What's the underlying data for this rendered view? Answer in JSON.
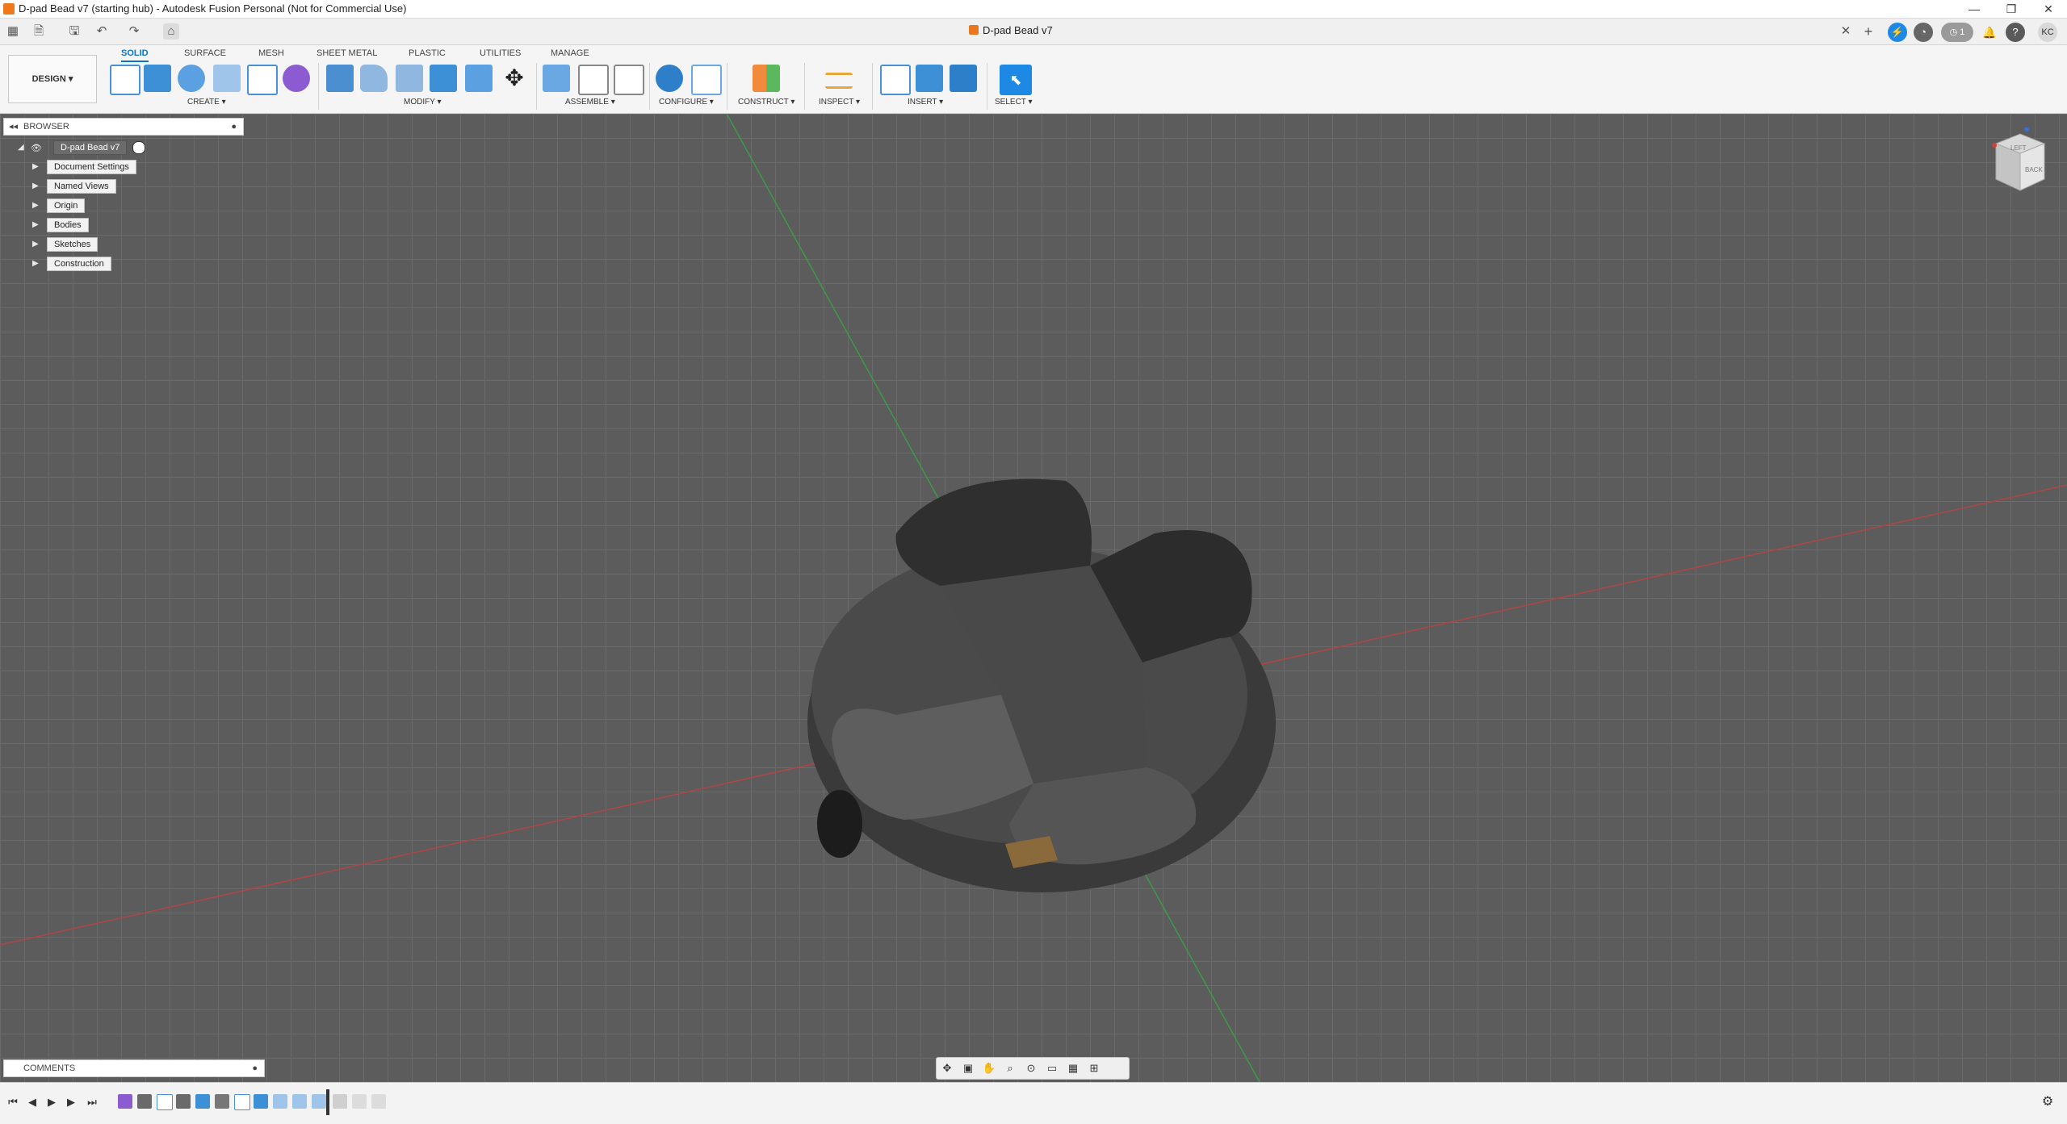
{
  "window": {
    "title": "D-pad Bead v7 (starting hub) - Autodesk Fusion Personal (Not for Commercial Use)",
    "minimize": "—",
    "restore": "❐",
    "close": "✕"
  },
  "quickbar": {
    "document_tab": "D-pad Bead v7",
    "tab_close": "✕",
    "add_tab": "+",
    "job_count": "1",
    "user_initials": "KC",
    "help": "?"
  },
  "ribbon": {
    "workspace": "DESIGN ▾",
    "tabs": [
      "SOLID",
      "SURFACE",
      "MESH",
      "SHEET METAL",
      "PLASTIC",
      "UTILITIES",
      "MANAGE"
    ],
    "groups": [
      "CREATE ▾",
      "MODIFY ▾",
      "ASSEMBLE ▾",
      "CONFIGURE ▾",
      "CONSTRUCT ▾",
      "INSPECT ▾",
      "INSERT ▾",
      "SELECT ▾"
    ]
  },
  "browser": {
    "header": "BROWSER",
    "root": "D-pad Bead v7",
    "items": [
      "Document Settings",
      "Named Views",
      "Origin",
      "Bodies",
      "Sketches",
      "Construction"
    ]
  },
  "comments": {
    "header": "COMMENTS"
  },
  "viewcube": {
    "top_label": "LEFT",
    "back_label": "BACK"
  },
  "colors": {
    "accent": "#0a74c8",
    "ribbon_bg": "#f5f5f5",
    "viewport_bg": "#5c5c5c",
    "grid_line": "#6a6a6a",
    "axis_red": "#b04545",
    "axis_green": "#3d9a4a",
    "model_body": "#3a3a3a",
    "select_tool": "#1e88e5"
  },
  "icons": {
    "grid": "grid-icon",
    "file": "file-icon",
    "save": "save-icon",
    "undo": "undo-icon",
    "redo": "redo-icon",
    "home": "home-icon",
    "settings": "gear-icon"
  }
}
